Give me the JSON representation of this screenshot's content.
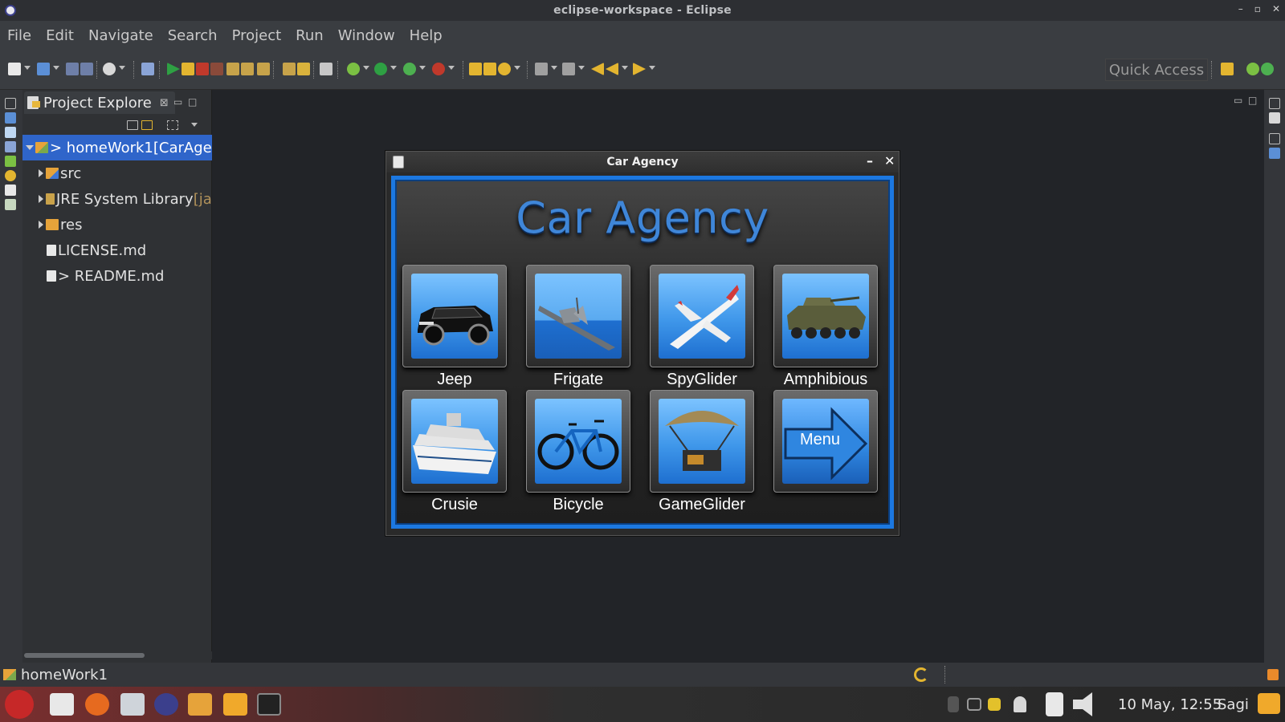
{
  "window": {
    "title": "eclipse-workspace - Eclipse",
    "controls": [
      "–",
      "▫",
      "✕"
    ]
  },
  "menubar": {
    "items": [
      "File",
      "Edit",
      "Navigate",
      "Search",
      "Project",
      "Run",
      "Window",
      "Help"
    ]
  },
  "toolbar": {
    "quick_access": "Quick Access",
    "accent_run": "#2ea043",
    "accent_debug": "#7bc043"
  },
  "explorer": {
    "tab_label": "Project Explore",
    "tab_close": "⊠",
    "tree": [
      {
        "label": "> homeWork1",
        "suffix": " [CarAger",
        "arrow": "open",
        "icon": "project-icon",
        "indent": 0,
        "selected": true
      },
      {
        "label": "src",
        "suffix": "",
        "arrow": "closed",
        "icon": "source-folder-icon",
        "indent": 1,
        "selected": false
      },
      {
        "label": "JRE System Library",
        "suffix": " [ja",
        "arrow": "closed",
        "icon": "library-icon",
        "indent": 1,
        "selected": false
      },
      {
        "label": "res",
        "suffix": "",
        "arrow": "closed",
        "icon": "folder-icon",
        "indent": 1,
        "selected": false
      },
      {
        "label": "LICENSE.md",
        "suffix": "",
        "arrow": "none",
        "icon": "file-icon",
        "indent": 1,
        "selected": false
      },
      {
        "label": "> README.md",
        "suffix": "",
        "arrow": "none",
        "icon": "file-icon",
        "indent": 1,
        "selected": false
      }
    ]
  },
  "car_agency": {
    "window_title": "Car Agency",
    "minimize": "–",
    "close": "✕",
    "heading": "Car Agency",
    "tiles": [
      {
        "label": "Jeep",
        "icon": "jeep-icon"
      },
      {
        "label": "Frigate",
        "icon": "frigate-icon"
      },
      {
        "label": "SpyGlider",
        "icon": "spyglider-icon"
      },
      {
        "label": "Amphibious",
        "icon": "amphibious-icon"
      },
      {
        "label": "Crusie",
        "icon": "cruise-ship-icon"
      },
      {
        "label": "Bicycle",
        "icon": "bicycle-icon"
      },
      {
        "label": "GameGlider",
        "icon": "gameglider-icon"
      },
      {
        "label": "",
        "icon": "menu-arrow-icon",
        "button_text": "Menu"
      }
    ],
    "accent_color": "#1c78e0"
  },
  "statusbar": {
    "project": "homeWork1"
  },
  "taskbar": {
    "clock": "10 May, 12:55",
    "user": "Sagi"
  }
}
